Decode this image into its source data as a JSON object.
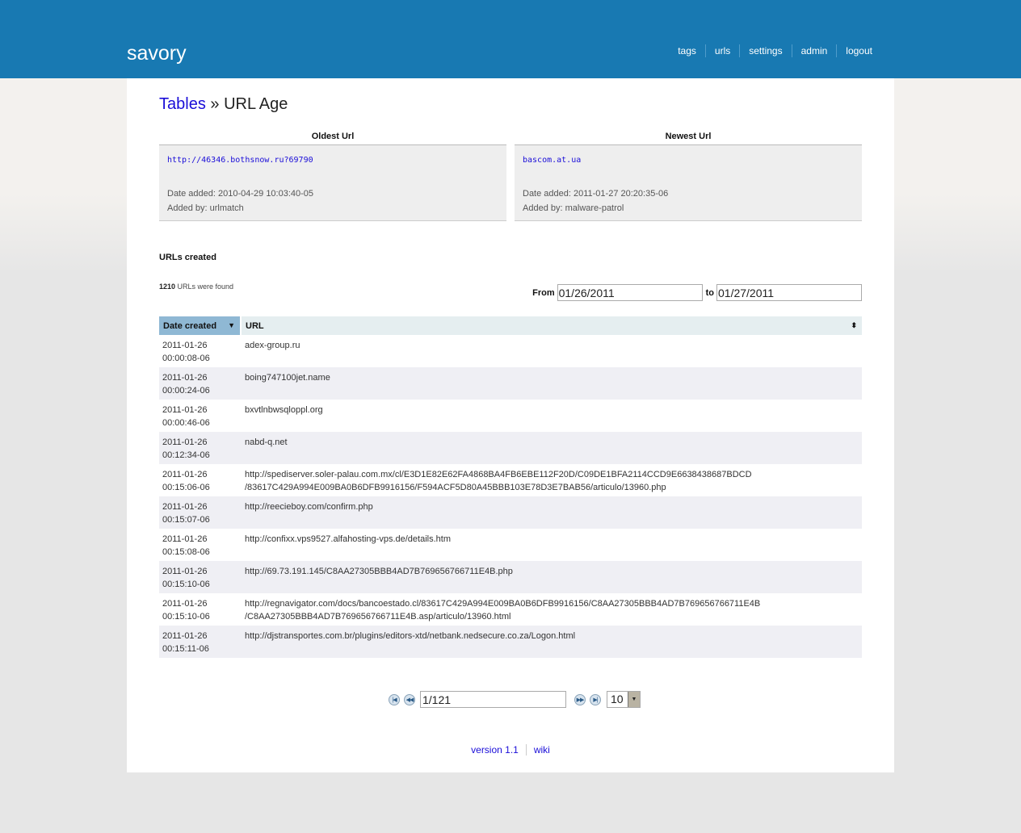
{
  "header": {
    "logo": "savory",
    "nav": [
      "tags",
      "urls",
      "settings",
      "admin",
      "logout"
    ]
  },
  "page": {
    "breadcrumb_link": "Tables",
    "breadcrumb_sep": "»",
    "title": "URL Age"
  },
  "oldest": {
    "heading": "Oldest Url",
    "url": "http://46346.bothsnow.ru?69790",
    "date_added": "Date added: 2010-04-29 10:03:40-05",
    "added_by": "Added by: urlmatch"
  },
  "newest": {
    "heading": "Newest Url",
    "url": "bascom.at.ua",
    "date_added": "Date added: 2011-01-27 20:20:35-06",
    "added_by": "Added by: malware-patrol"
  },
  "created": {
    "section_title": "URLs created",
    "count": "1210",
    "count_suffix": " URLs were found",
    "from_label": "From",
    "from_value": "01/26/2011",
    "to_label": "to",
    "to_value": "01/27/2011"
  },
  "table": {
    "columns": [
      "Date created",
      "URL"
    ],
    "rows": [
      {
        "date": "2011-01-26",
        "time": "00:00:08-06",
        "url": "adex-group.ru",
        "url2": ""
      },
      {
        "date": "2011-01-26",
        "time": "00:00:24-06",
        "url": "boing747100jet.name",
        "url2": ""
      },
      {
        "date": "2011-01-26",
        "time": "00:00:46-06",
        "url": "bxvtlnbwsqloppl.org",
        "url2": ""
      },
      {
        "date": "2011-01-26",
        "time": "00:12:34-06",
        "url": "nabd-q.net",
        "url2": ""
      },
      {
        "date": "2011-01-26",
        "time": "00:15:06-06",
        "url": "http://spediserver.soler-palau.com.mx/cl/E3D1E82E62FA4868BA4FB6EBE112F20D/C09DE1BFA2114CCD9E6638438687BDCD",
        "url2": "/83617C429A994E009BA0B6DFB9916156/F594ACF5D80A45BBB103E78D3E7BAB56/articulo/13960.php"
      },
      {
        "date": "2011-01-26",
        "time": "00:15:07-06",
        "url": "http://reecieboy.com/confirm.php",
        "url2": ""
      },
      {
        "date": "2011-01-26",
        "time": "00:15:08-06",
        "url": "http://confixx.vps9527.alfahosting-vps.de/details.htm",
        "url2": ""
      },
      {
        "date": "2011-01-26",
        "time": "00:15:10-06",
        "url": "http://69.73.191.145/C8AA27305BBB4AD7B769656766711E4B.php",
        "url2": ""
      },
      {
        "date": "2011-01-26",
        "time": "00:15:10-06",
        "url": "http://regnavigator.com/docs/bancoestado.cl/83617C429A994E009BA0B6DFB9916156/C8AA27305BBB4AD7B769656766711E4B",
        "url2": "/C8AA27305BBB4AD7B769656766711E4B.asp/articulo/13960.html"
      },
      {
        "date": "2011-01-26",
        "time": "00:15:11-06",
        "url": "http://djstransportes.com.br/plugins/editors-xtd/netbank.nedsecure.co.za/Logon.html",
        "url2": ""
      }
    ]
  },
  "pager": {
    "page": "1/121",
    "page_size": "10"
  },
  "footer": {
    "links": [
      "version 1.1",
      "wiki"
    ]
  }
}
